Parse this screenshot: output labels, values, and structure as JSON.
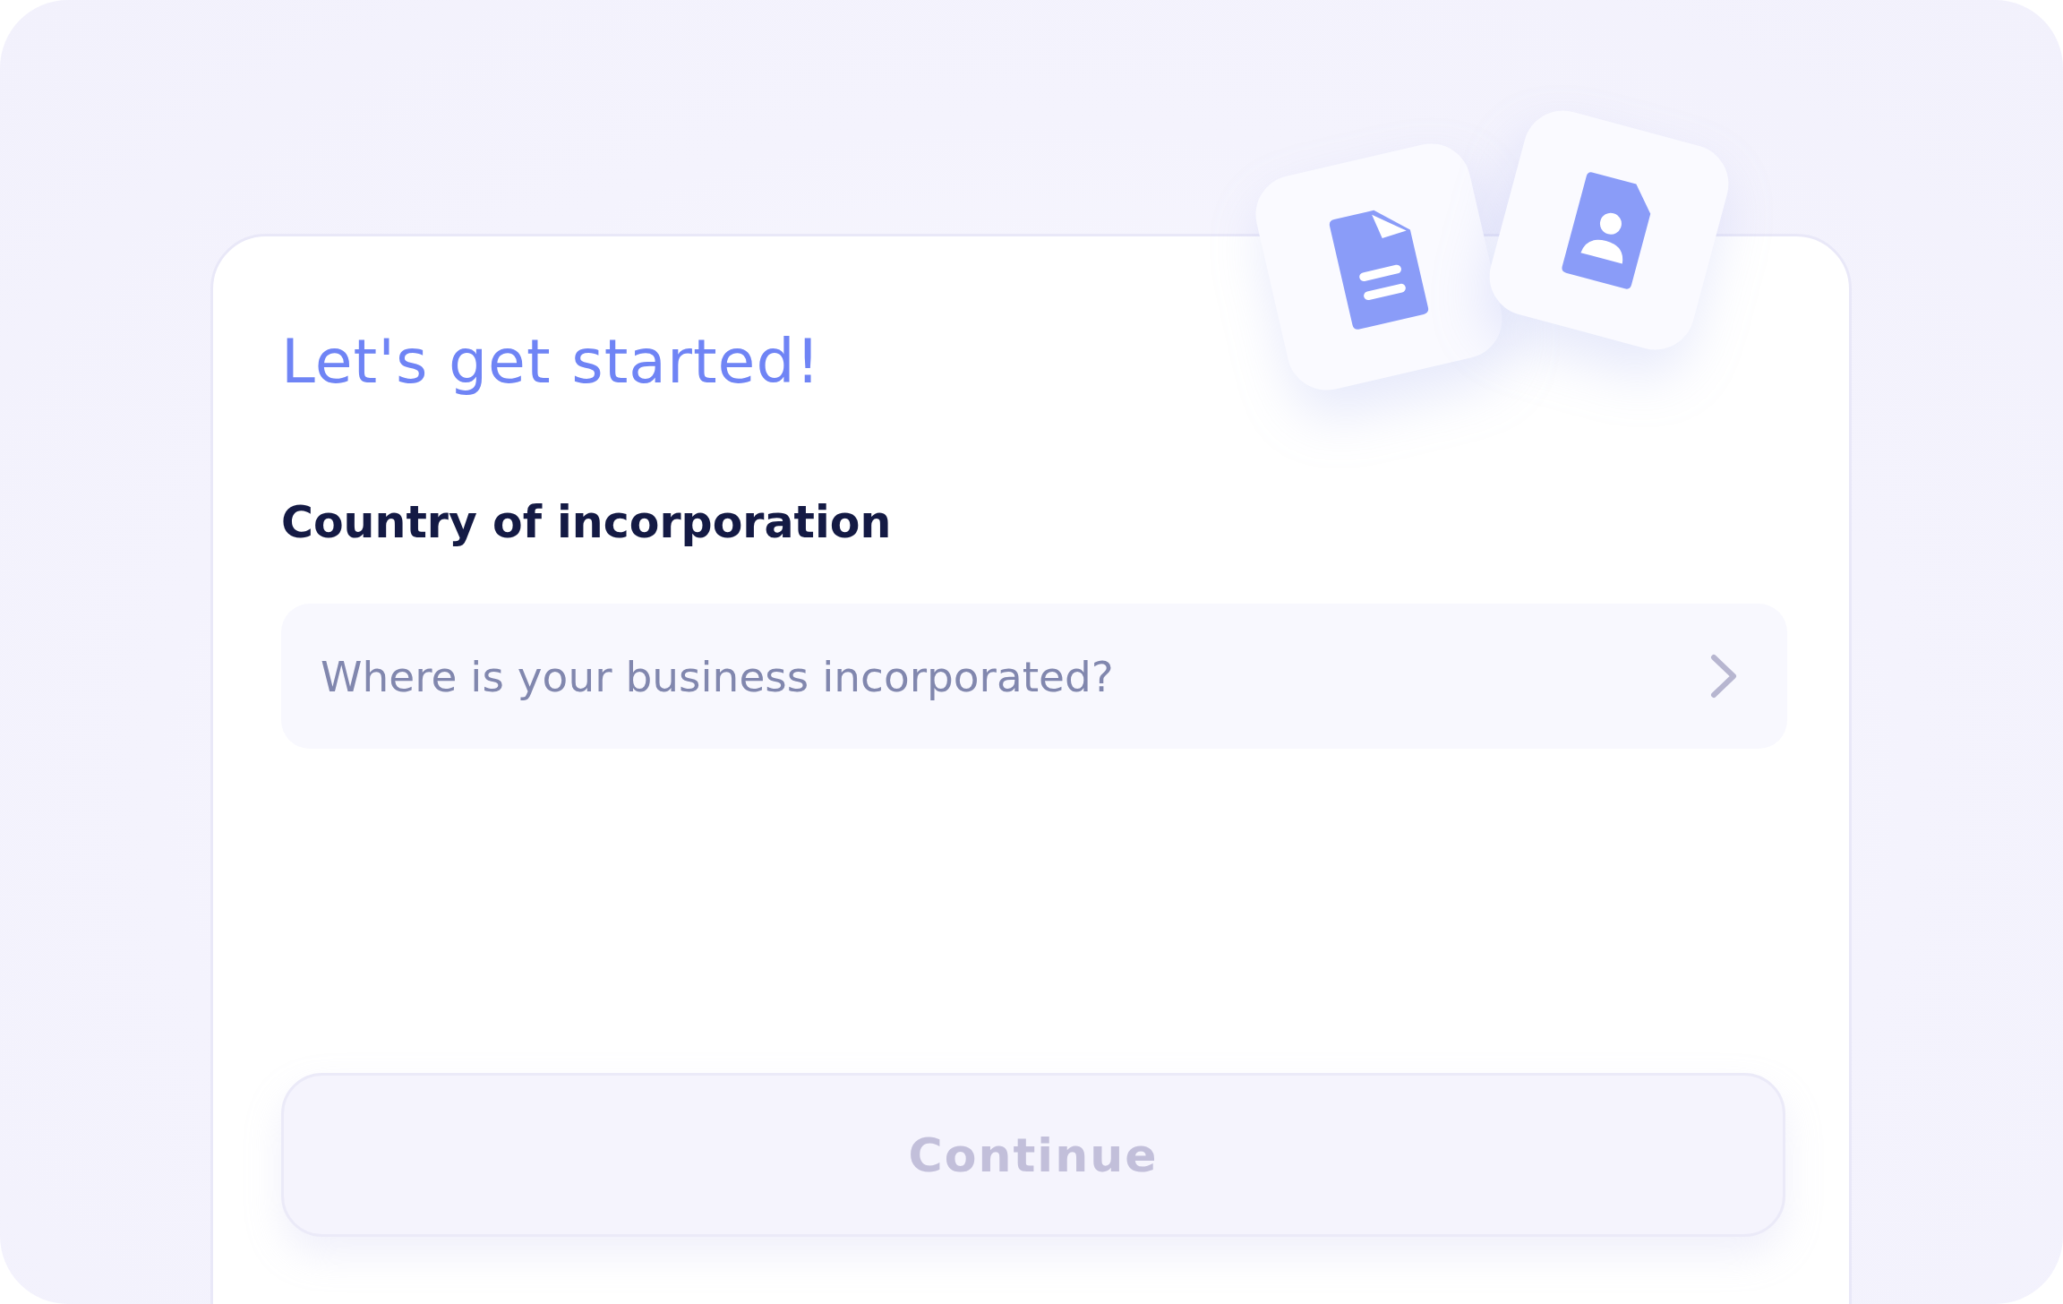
{
  "title": "Let's get started!",
  "field": {
    "label": "Country of incorporation",
    "placeholder": "Where is your business incorporated?"
  },
  "continue_button": {
    "label": "Continue",
    "disabled": true
  }
}
